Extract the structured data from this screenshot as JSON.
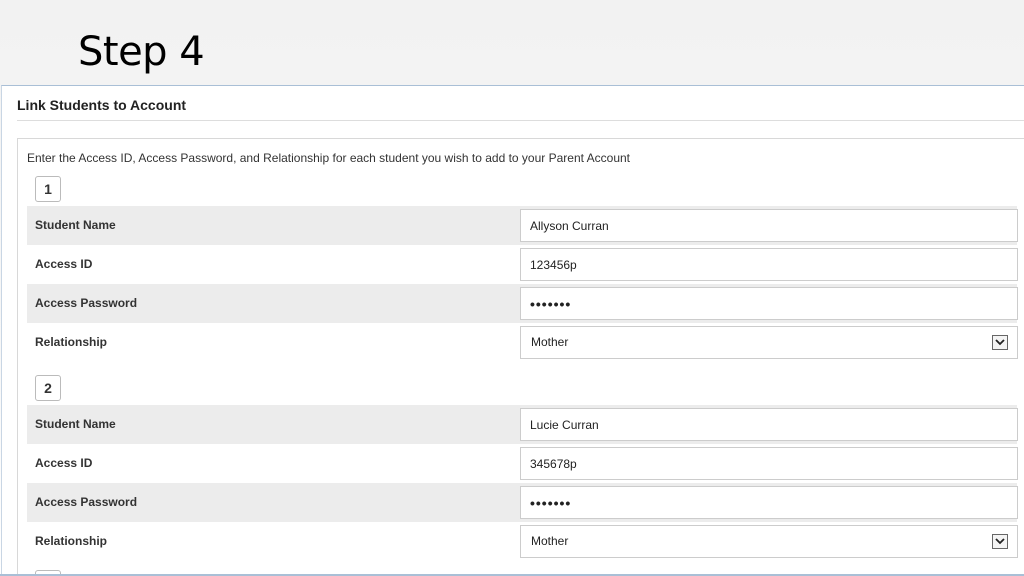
{
  "slide": {
    "title": "Step 4"
  },
  "section": {
    "title": "Link Students to Account",
    "instructions": "Enter the Access ID, Access Password, and Relationship for each student you wish to add to your Parent Account"
  },
  "labels": {
    "student_name": "Student Name",
    "access_id": "Access ID",
    "access_password": "Access Password",
    "relationship": "Relationship"
  },
  "students": [
    {
      "number": "1",
      "student_name": "Allyson Curran",
      "access_id": "123456p",
      "access_password": "•••••••",
      "relationship": "Mother"
    },
    {
      "number": "2",
      "student_name": "Lucie Curran",
      "access_id": "345678p",
      "access_password": "•••••••",
      "relationship": "Mother"
    }
  ],
  "icons": {
    "dropdown": "chevron-down-icon"
  },
  "colors": {
    "row_shade": "#ececec",
    "frame_border": "#a9bfd6"
  }
}
